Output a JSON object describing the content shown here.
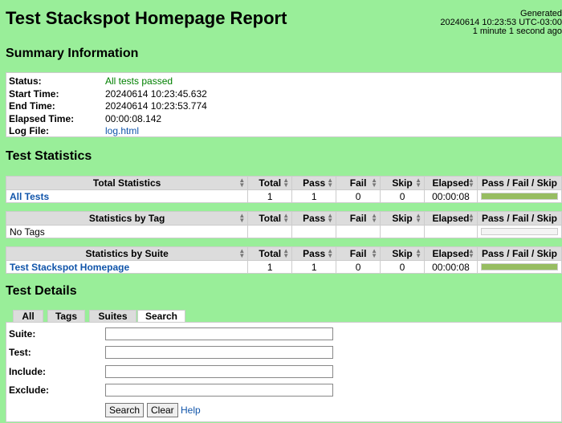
{
  "header": {
    "title": "Test Stackspot Homepage Report",
    "generated_label": "Generated",
    "generated_time": "20240614 10:23:53 UTC-03:00",
    "generated_ago": "1 minute 1 second ago"
  },
  "summary": {
    "title": "Summary Information",
    "status_label": "Status:",
    "status_value": "All tests passed",
    "start_label": "Start Time:",
    "start_value": "20240614 10:23:45.632",
    "end_label": "End Time:",
    "end_value": "20240614 10:23:53.774",
    "elapsed_label": "Elapsed Time:",
    "elapsed_value": "00:00:08.142",
    "log_label": "Log File:",
    "log_value": "log.html"
  },
  "statistics": {
    "title": "Test Statistics",
    "columns": {
      "total": "Total",
      "pass": "Pass",
      "fail": "Fail",
      "skip": "Skip",
      "elapsed": "Elapsed",
      "graph": "Pass / Fail / Skip"
    },
    "total_table": {
      "header": "Total Statistics",
      "row": {
        "name": "All Tests",
        "total": "1",
        "pass": "1",
        "fail": "0",
        "skip": "0",
        "elapsed": "00:00:08",
        "pass_ratio": 1.0
      }
    },
    "tag_table": {
      "header": "Statistics by Tag",
      "row": {
        "name": "No Tags",
        "total": "",
        "pass": "",
        "fail": "",
        "skip": "",
        "elapsed": "",
        "pass_ratio": 0
      }
    },
    "suite_table": {
      "header": "Statistics by Suite",
      "row": {
        "name": "Test Stackspot Homepage",
        "total": "1",
        "pass": "1",
        "fail": "0",
        "skip": "0",
        "elapsed": "00:00:08",
        "pass_ratio": 1.0
      }
    }
  },
  "details": {
    "title": "Test Details",
    "tabs": [
      "All",
      "Tags",
      "Suites",
      "Search"
    ],
    "active_tab": "Search",
    "suite_label": "Suite:",
    "test_label": "Test:",
    "include_label": "Include:",
    "exclude_label": "Exclude:",
    "search_button": "Search",
    "clear_button": "Clear",
    "help_link": "Help"
  },
  "colors": {
    "background": "#99ee99",
    "pass": "#97bd61",
    "link": "#1155aa"
  }
}
